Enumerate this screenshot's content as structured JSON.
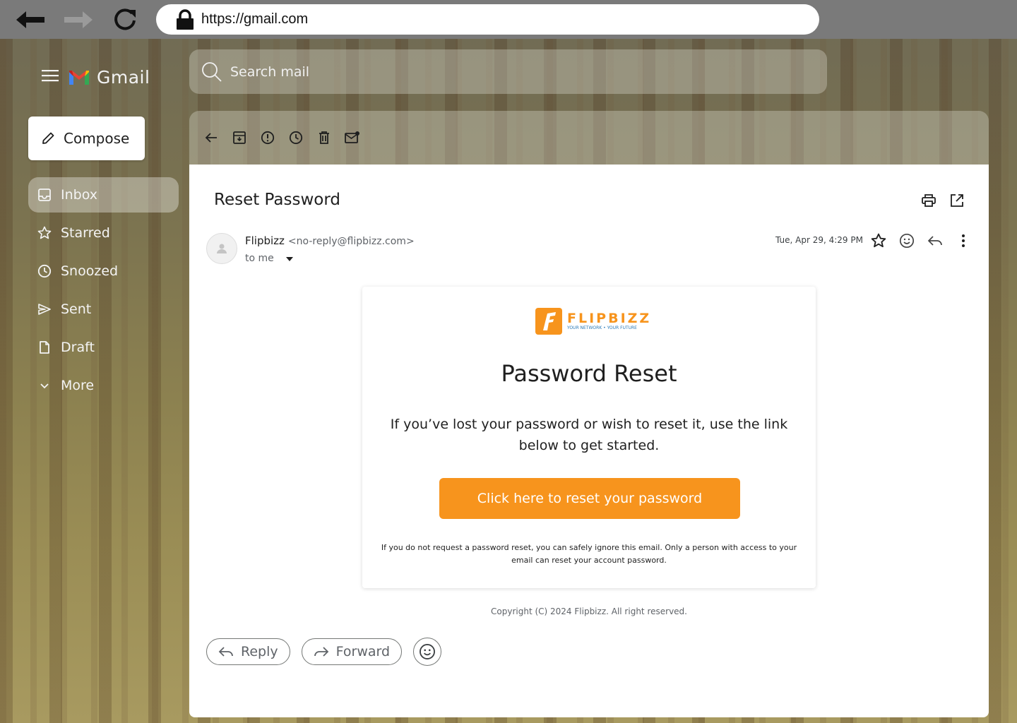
{
  "browser": {
    "url": "https://gmail.com",
    "back_icon": "arrow-left-icon",
    "forward_icon": "arrow-right-icon",
    "reload_icon": "reload-icon"
  },
  "app": {
    "name": "Gmail",
    "compose_label": "Compose"
  },
  "sidebar": {
    "items": [
      {
        "label": "Inbox",
        "icon": "inbox-icon",
        "active": true
      },
      {
        "label": "Starred",
        "icon": "star-icon"
      },
      {
        "label": "Snoozed",
        "icon": "clock-icon"
      },
      {
        "label": "Sent",
        "icon": "send-icon"
      },
      {
        "label": "Draft",
        "icon": "file-icon"
      },
      {
        "label": "More",
        "icon": "chevron-down-icon"
      }
    ]
  },
  "search": {
    "placeholder": "Search mail"
  },
  "toolbar": {
    "icons": [
      "back-arrow-icon",
      "archive-icon",
      "report-spam-icon",
      "snooze-icon",
      "delete-icon",
      "mark-unread-icon"
    ]
  },
  "email": {
    "subject": "Reset Password",
    "sender_name": "Flipbizz",
    "sender_email": "<no-reply@flipbizz.com>",
    "recipient": "to me",
    "date": "Tue, Apr 29, 4:29 PM"
  },
  "message": {
    "brand_name": "FLIPBIZZ",
    "brand_tagline": "YOUR NETWORK • YOUR FUTURE",
    "title": "Password Reset",
    "body": "If you’ve lost your password or wish to reset it, use the link below to get started.",
    "button_label": "Click here to reset your password",
    "note": "If you do not request a password reset, you can safely ignore this email. Only a person with access to your email can reset your account password.",
    "copyright": "Copyright (C) 2024 Flipbizz. All right reserved."
  },
  "actions": {
    "reply_label": "Reply",
    "forward_label": "Forward"
  },
  "colors": {
    "accent": "#f7941d",
    "brand_blue": "#2a7ab8"
  }
}
